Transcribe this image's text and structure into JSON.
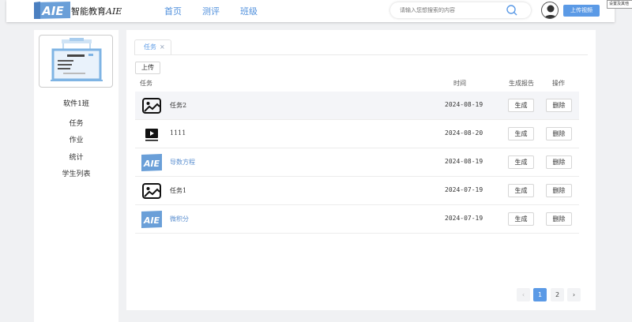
{
  "header": {
    "brand_prefix": "智能教育",
    "brand_suffix": "AIE",
    "logo_text": "AIE",
    "nav": [
      "首页",
      "测评",
      "班级"
    ],
    "search_placeholder": "请输入您想搜索的内容",
    "upload_video_label": "上传视频",
    "settings_tip": "设置及其他"
  },
  "sidebar": {
    "class_name": "软件1班",
    "items": [
      "任务",
      "作业",
      "统计",
      "学生列表"
    ]
  },
  "main": {
    "tab": {
      "label": "任务",
      "close": "×"
    },
    "upload_label": "上传",
    "columns": {
      "task": "任务",
      "time": "时间",
      "report": "生成报告",
      "action": "操作"
    },
    "rows": [
      {
        "icon": "image-icon",
        "name": "任务2",
        "date": "2024-08-19",
        "generate": "生成",
        "delete": "删除"
      },
      {
        "icon": "video-icon",
        "name": "1111",
        "date": "2024-08-20",
        "generate": "生成",
        "delete": "删除"
      },
      {
        "icon": "aie-logo-icon",
        "name": "导数方程",
        "date": "2024-08-19",
        "generate": "生成",
        "delete": "删除"
      },
      {
        "icon": "image-icon",
        "name": "任务1",
        "date": "2024-07-19",
        "generate": "生成",
        "delete": "删除"
      },
      {
        "icon": "aie-logo-icon",
        "name": "微积分",
        "date": "2024-07-19",
        "generate": "生成",
        "delete": "删除"
      }
    ],
    "pagination": {
      "prev": "‹",
      "pages": [
        "1",
        "2"
      ],
      "next": "›",
      "current": 1
    }
  },
  "colors": {
    "accent": "#5b9ae6",
    "link": "#5b8fd0",
    "row_highlight": "#f4f5f8"
  }
}
